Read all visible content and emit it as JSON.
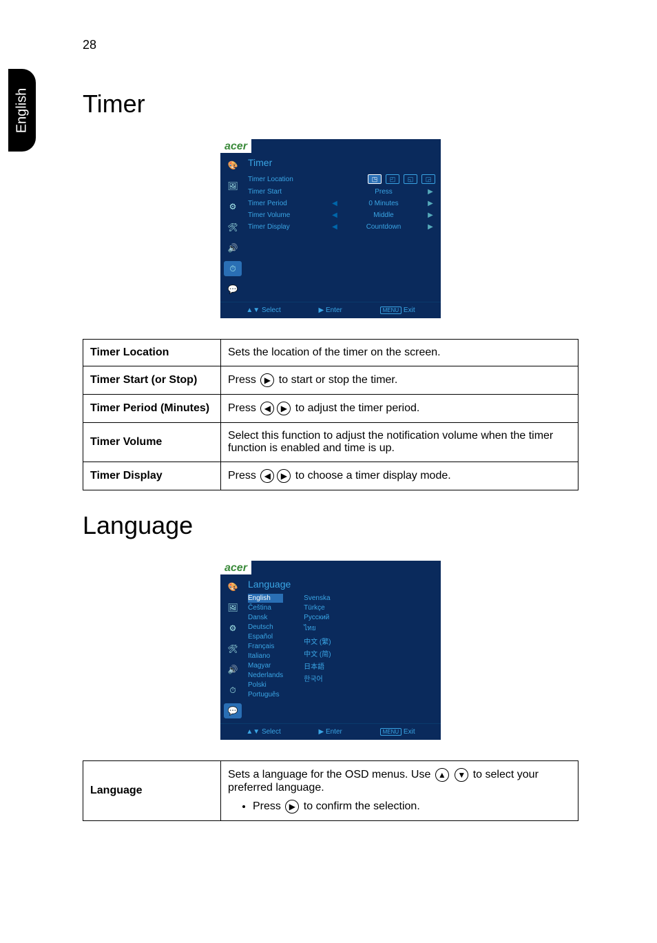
{
  "page_number": "28",
  "side_tab": "English",
  "sections": {
    "timer": {
      "heading": "Timer",
      "osd": {
        "logo": "acer",
        "title": "Timer",
        "rows": [
          {
            "label": "Timer Location",
            "value_icons": true
          },
          {
            "label": "Timer Start",
            "value": "Press",
            "right_arrow": true
          },
          {
            "label": "Timer Period",
            "left_arrow": true,
            "value": "0  Minutes",
            "right_arrow": true
          },
          {
            "label": "Timer Volume",
            "left_arrow": true,
            "value": "Middle",
            "right_arrow": true
          },
          {
            "label": "Timer Display",
            "left_arrow": true,
            "value": "Countdown",
            "right_arrow": true
          }
        ],
        "footer": {
          "select": "Select",
          "enter": "Enter",
          "exit_key": "MENU",
          "exit": "Exit"
        }
      },
      "table": [
        {
          "label": "Timer Location",
          "desc": "Sets the location of the timer on the screen."
        },
        {
          "label": "Timer Start (or Stop)",
          "desc_pre": "Press ",
          "icons": [
            "▶"
          ],
          "desc_post": " to start or stop the timer."
        },
        {
          "label": "Timer Period (Minutes)",
          "desc_pre": "Press ",
          "icons": [
            "◀",
            "▶"
          ],
          "desc_post": " to adjust the timer period."
        },
        {
          "label": "Timer Volume",
          "desc": "Select this function to adjust the notification volume when the timer function is enabled and time is up."
        },
        {
          "label": "Timer Display",
          "desc_pre": "Press ",
          "icons": [
            "◀",
            "▶"
          ],
          "desc_post": " to choose a timer display mode."
        }
      ]
    },
    "language": {
      "heading": "Language",
      "osd": {
        "logo": "acer",
        "title": "Language",
        "col1": [
          "English",
          "Čeština",
          "Dansk",
          "Deutsch",
          "Español",
          "Français",
          "Italiano",
          "Magyar",
          "Nederlands",
          "Polski",
          "Português"
        ],
        "col2": [
          "Svenska",
          "Türkçe",
          "Русский",
          "ไทย",
          "中文 (繁)",
          "中文 (简)",
          "日本語",
          "한국어"
        ],
        "footer": {
          "select": "Select",
          "enter": "Enter",
          "exit_key": "MENU",
          "exit": "Exit"
        }
      },
      "table": {
        "label": "Language",
        "desc_pre": "Sets a language for the OSD menus. Use ",
        "icons1": [
          "▲",
          "▼"
        ],
        "desc_mid": " to select your preferred language.",
        "bullet_pre": "Press ",
        "bullet_icons": [
          "▶"
        ],
        "bullet_post": " to confirm the selection."
      }
    }
  }
}
